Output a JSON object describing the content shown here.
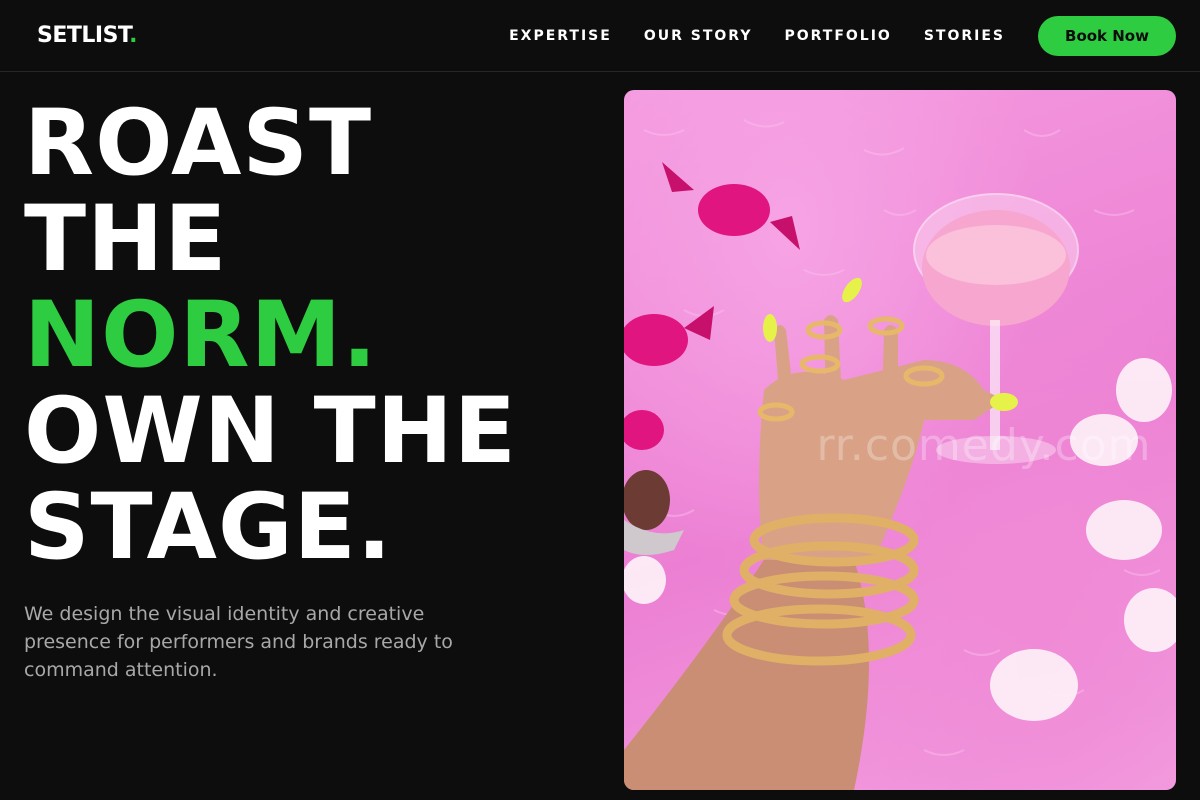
{
  "brand": {
    "name": "SETLIST",
    "dot": "."
  },
  "nav": {
    "links": [
      "EXPERTISE",
      "OUR STORY",
      "PORTFOLIO",
      "STORIES"
    ],
    "cta": "Book Now"
  },
  "hero": {
    "lines": [
      "ROAST",
      "THE",
      "NORM.",
      "OWN THE",
      "STAGE."
    ],
    "accent_line_index": 2,
    "subtitle": "We design the visual identity and creative presence for performers and brands ready to command attention."
  },
  "image": {
    "description_icon": "jewelry-hand-photo",
    "watermark": "rr.comedy.com"
  },
  "colors": {
    "accent": "#2ecc40",
    "background": "#0d0d0d",
    "muted_text": "#a8a8a8"
  }
}
